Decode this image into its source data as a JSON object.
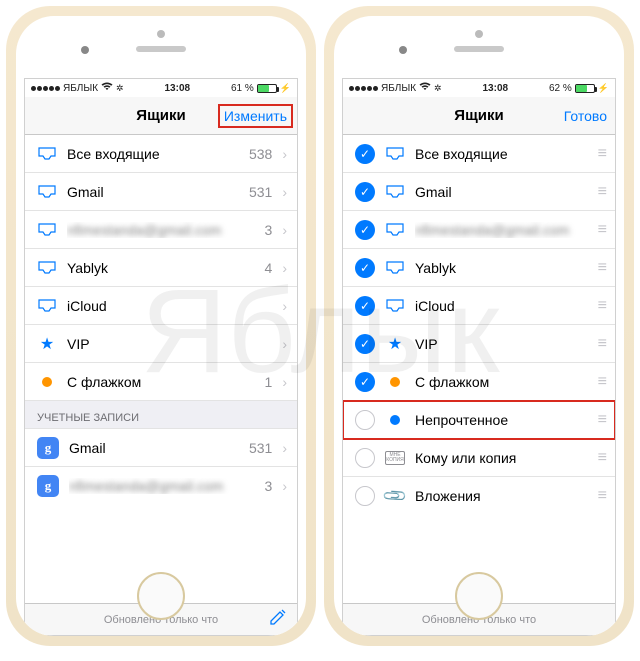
{
  "watermark": "Яблык",
  "statusbar": {
    "carrier": "ЯБЛЫК",
    "time": "13:08",
    "battery_left": "61 %",
    "battery_right": "62 %"
  },
  "left": {
    "nav_title": "Ящики",
    "nav_action": "Изменить",
    "items": [
      {
        "icon": "inbox",
        "label": "Все входящие",
        "count": "538"
      },
      {
        "icon": "inbox",
        "label": "Gmail",
        "count": "531"
      },
      {
        "icon": "inbox",
        "label": "nfimestanda@gmail.com",
        "count": "3",
        "blurred": true
      },
      {
        "icon": "inbox",
        "label": "Yablyk",
        "count": "4"
      },
      {
        "icon": "inbox",
        "label": "iCloud",
        "count": ""
      },
      {
        "icon": "star",
        "label": "VIP",
        "count": ""
      },
      {
        "icon": "flag",
        "label": "С флажком",
        "count": "1"
      }
    ],
    "section_header": "УЧЕТНЫЕ ЗАПИСИ",
    "accounts": [
      {
        "label": "Gmail",
        "count": "531"
      },
      {
        "label": "nfimestanda@gmail.com",
        "count": "3",
        "blurred": true
      }
    ],
    "toolbar_text": "Обновлено только что"
  },
  "right": {
    "nav_title": "Ящики",
    "nav_action": "Готово",
    "items": [
      {
        "checked": true,
        "icon": "inbox",
        "label": "Все входящие"
      },
      {
        "checked": true,
        "icon": "inbox",
        "label": "Gmail"
      },
      {
        "checked": true,
        "icon": "inbox",
        "label": "nfimestanda@gmail.com",
        "blurred": true
      },
      {
        "checked": true,
        "icon": "inbox",
        "label": "Yablyk"
      },
      {
        "checked": true,
        "icon": "inbox",
        "label": "iCloud"
      },
      {
        "checked": true,
        "icon": "star",
        "label": "VIP"
      },
      {
        "checked": true,
        "icon": "flag",
        "label": "С флажком"
      },
      {
        "checked": false,
        "icon": "bluedot",
        "label": "Непрочтенное",
        "highlight": true
      },
      {
        "checked": false,
        "icon": "tocc",
        "label": "Кому или копия"
      },
      {
        "checked": false,
        "icon": "clip",
        "label": "Вложения"
      }
    ],
    "toolbar_text": "Обновлено только что"
  },
  "tocc_lines": {
    "l1": "МНЕ",
    "l2": "КОПИЯ"
  }
}
